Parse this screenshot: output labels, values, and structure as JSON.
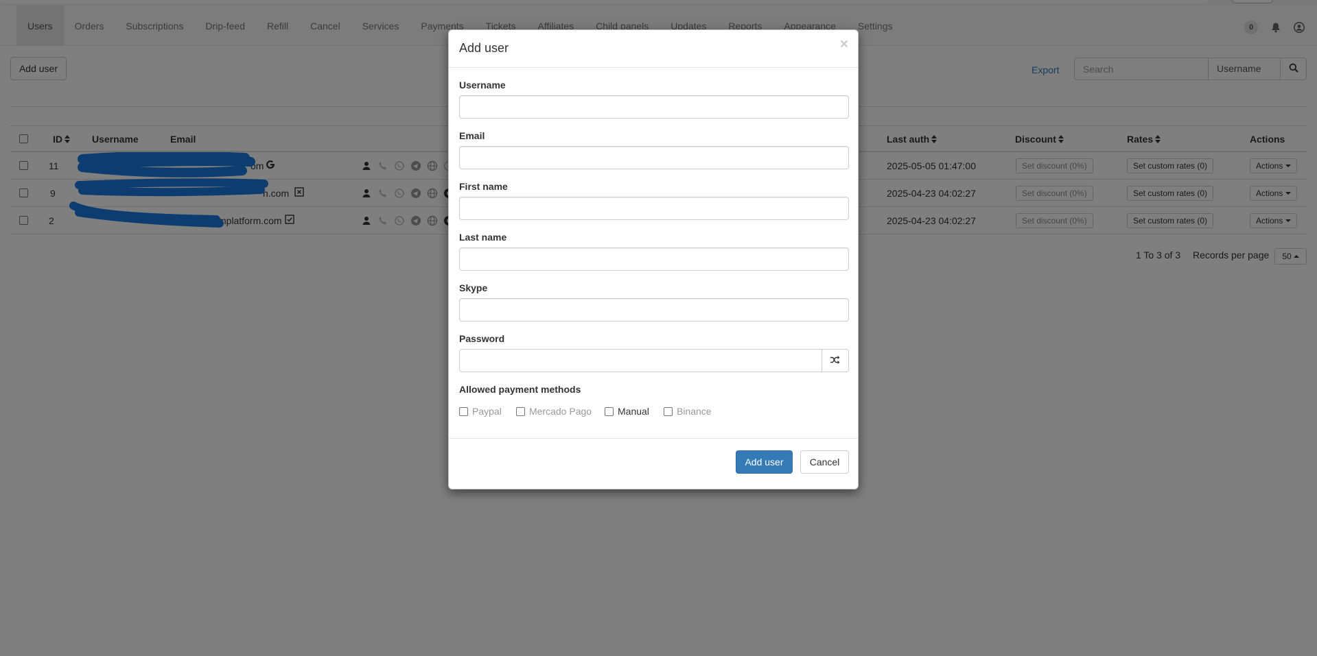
{
  "nav": {
    "items": [
      "Users",
      "Orders",
      "Subscriptions",
      "Drip-feed",
      "Refill",
      "Cancel",
      "Services",
      "Payments",
      "Tickets",
      "Affiliates",
      "Child panels",
      "Updates",
      "Reports",
      "Appearance",
      "Settings"
    ],
    "active": "Users",
    "notification_count": "0"
  },
  "toolbar": {
    "add_user_label": "Add user",
    "export_label": "Export",
    "search_placeholder": "Search",
    "search_field": "Username"
  },
  "table": {
    "headers": {
      "id": "ID",
      "username": "Username",
      "email": "Email",
      "last_auth": "Last auth",
      "discount": "Discount",
      "rates": "Rates",
      "actions": "Actions"
    },
    "rows": [
      {
        "id": "11",
        "email_tail": "om",
        "last_auth": "2025-05-05 01:47:00",
        "discount": "Set discount (0%)",
        "rates": "Set custom rates (0)",
        "actions": "Actions",
        "email_badge": "google-icon"
      },
      {
        "id": "9",
        "email_tail": "n.com",
        "last_auth": "2025-04-23 04:02:27",
        "discount": "Set discount (0%)",
        "rates": "Set custom rates (0)",
        "actions": "Actions",
        "email_badge": "unverified-email-icon"
      },
      {
        "id": "2",
        "email_tail": "mplatform.com",
        "last_auth": "2025-04-23 04:02:27",
        "discount": "Set discount (0%)",
        "rates": "Set custom rates (0)",
        "actions": "Actions",
        "email_badge": "verified-email-icon"
      }
    ],
    "pager_text": "1 To 3 of 3",
    "records_per_page_label": "Records per page",
    "records_per_page_value": "50"
  },
  "modal": {
    "title": "Add user",
    "fields": {
      "username": {
        "label": "Username",
        "value": ""
      },
      "email": {
        "label": "Email",
        "value": ""
      },
      "first_name": {
        "label": "First name",
        "value": ""
      },
      "last_name": {
        "label": "Last name",
        "value": ""
      },
      "skype": {
        "label": "Skype",
        "value": ""
      },
      "password": {
        "label": "Password",
        "value": ""
      }
    },
    "payment_methods_label": "Allowed payment methods",
    "payment_methods": [
      {
        "label": "Paypal",
        "enabled": false,
        "checked": false
      },
      {
        "label": "Mercado Pago",
        "enabled": false,
        "checked": false
      },
      {
        "label": "Manual",
        "enabled": true,
        "checked": false
      },
      {
        "label": "Binance",
        "enabled": false,
        "checked": false
      }
    ],
    "submit_label": "Add user",
    "cancel_label": "Cancel"
  },
  "colors": {
    "primary": "#337ab7",
    "link": "#337ab7",
    "redaction": "#1a7be0",
    "backdrop": "rgba(0,0,0,0.5)"
  }
}
